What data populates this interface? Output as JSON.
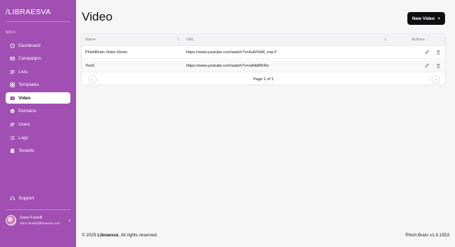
{
  "brand": {
    "logo": "/LIBRAESVA",
    "accent": "#a14fb3"
  },
  "sidebar": {
    "section_label": "MAIN",
    "items": [
      {
        "label": "Dashboard",
        "icon": "dashboard-icon",
        "active": false
      },
      {
        "label": "Campaigns",
        "icon": "campaigns-icon",
        "active": false
      },
      {
        "label": "Lists",
        "icon": "lists-icon",
        "active": false
      },
      {
        "label": "Templates",
        "icon": "templates-icon",
        "active": false
      },
      {
        "label": "Video",
        "icon": "video-icon",
        "active": true
      },
      {
        "label": "Domains",
        "icon": "domains-icon",
        "active": false
      },
      {
        "label": "Users",
        "icon": "users-icon",
        "active": false
      },
      {
        "label": "Logs",
        "icon": "logs-icon",
        "active": false
      },
      {
        "label": "Tenants",
        "icon": "tenants-icon",
        "active": false
      }
    ],
    "support": {
      "label": "Support",
      "icon": "headset-icon"
    },
    "user": {
      "name": "Dario Fanelli",
      "email": "dario.fanelli@libraesva.com"
    }
  },
  "main": {
    "title": "Video",
    "new_button": {
      "label": "New Video",
      "icon": "plus-icon"
    },
    "table": {
      "columns": [
        "Name",
        "URL",
        "Actions"
      ],
      "rows": [
        {
          "name": "PhishBrain Video Demo",
          "url": "https://www.youtube.com/watch?v=4uWXkM_macY"
        },
        {
          "name": "Test1",
          "url": "https://www.youtube.com/watch?v=oj4ddR53lo"
        }
      ],
      "pagination": {
        "label": "Page 1 of 1",
        "prev_icon": "arrow-left-icon",
        "next_icon": "arrow-right-icon"
      }
    }
  },
  "footer": {
    "copyright_prefix": "© 2025 ",
    "company": "Libraesva",
    "copyright_suffix": ". All rights reserved.",
    "version": "Phish Brain v1.0.1553"
  }
}
